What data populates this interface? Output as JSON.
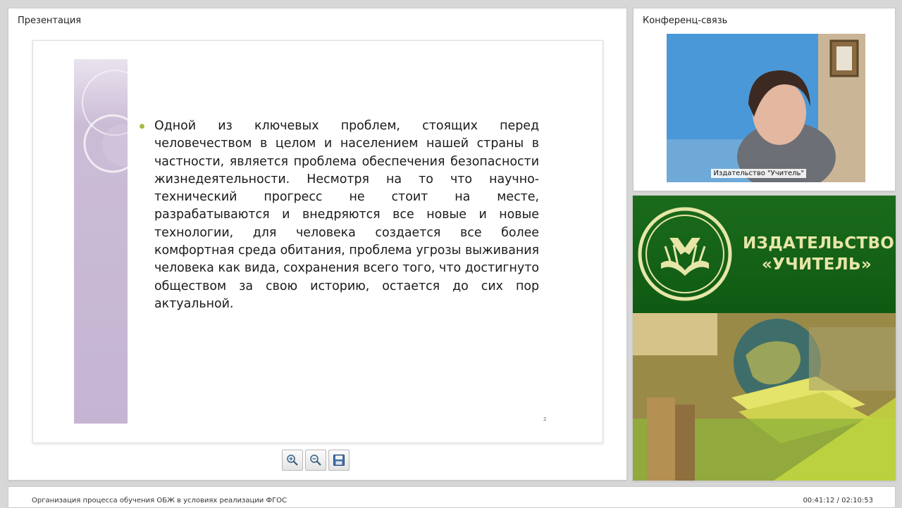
{
  "presentation": {
    "title": "Презентация",
    "slide_text": "Одной из ключевых проблем, стоящих перед человечеством в целом и населением нашей страны в частности, является проблема обеспечения безопасности жизнедеятельности. Несмотря на то что научно-технический прогресс не стоит на месте, разрабатываются и внедряются все новые и новые технологии, для человека создается все более комфортная среда обитания, проблема угрозы выживания человека как вида, сохранения всего того, что достигнуто обществом за свою историю, остается до сих пор актуальной.",
    "page_number": "2",
    "tools": [
      {
        "name": "zoom-in",
        "icon": "zoom-in-icon"
      },
      {
        "name": "zoom-out",
        "icon": "zoom-out-icon"
      },
      {
        "name": "save",
        "icon": "floppy-disk-icon"
      }
    ]
  },
  "conference": {
    "title": "Конференц-связь",
    "camera_label": "Издательство \"Учитель\""
  },
  "brand": {
    "name_line1": "ИЗДАТЕЛЬСТВО",
    "name_line2": "«УЧИТЕЛЬ»",
    "accent": "#1b6b1c",
    "text_color": "#e7e6a8"
  },
  "status": {
    "course_title": "Организация процесса обучения ОБЖ в условиях реализации ФГОС",
    "time": "00:41:12 / 02:10:53"
  }
}
